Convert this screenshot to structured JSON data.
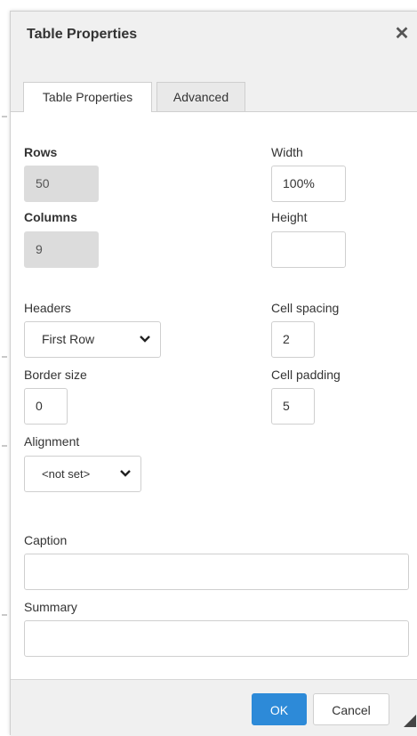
{
  "dialog": {
    "title": "Table Properties",
    "close_glyph": "✕",
    "tabs": [
      {
        "label": "Table Properties",
        "active": true
      },
      {
        "label": "Advanced",
        "active": false
      }
    ]
  },
  "form": {
    "rows": {
      "label": "Rows",
      "value": "50"
    },
    "columns": {
      "label": "Columns",
      "value": "9"
    },
    "width": {
      "label": "Width",
      "value": "100%"
    },
    "height": {
      "label": "Height",
      "value": ""
    },
    "headers": {
      "label": "Headers",
      "value": "First Row"
    },
    "cell_spacing": {
      "label": "Cell spacing",
      "value": "2"
    },
    "border_size": {
      "label": "Border size",
      "value": "0"
    },
    "cell_padding": {
      "label": "Cell padding",
      "value": "5"
    },
    "alignment": {
      "label": "Alignment",
      "value": "<not set>"
    },
    "caption": {
      "label": "Caption",
      "value": ""
    },
    "summary": {
      "label": "Summary",
      "value": ""
    }
  },
  "footer": {
    "ok_label": "OK",
    "cancel_label": "Cancel"
  },
  "colors": {
    "primary_button": "#2d8ad8",
    "panel_bg": "#f0f0f0",
    "disabled_field": "#dcdcdc"
  },
  "icons": [
    "close-icon",
    "chevron-down-icon",
    "resize-handle-icon"
  ]
}
